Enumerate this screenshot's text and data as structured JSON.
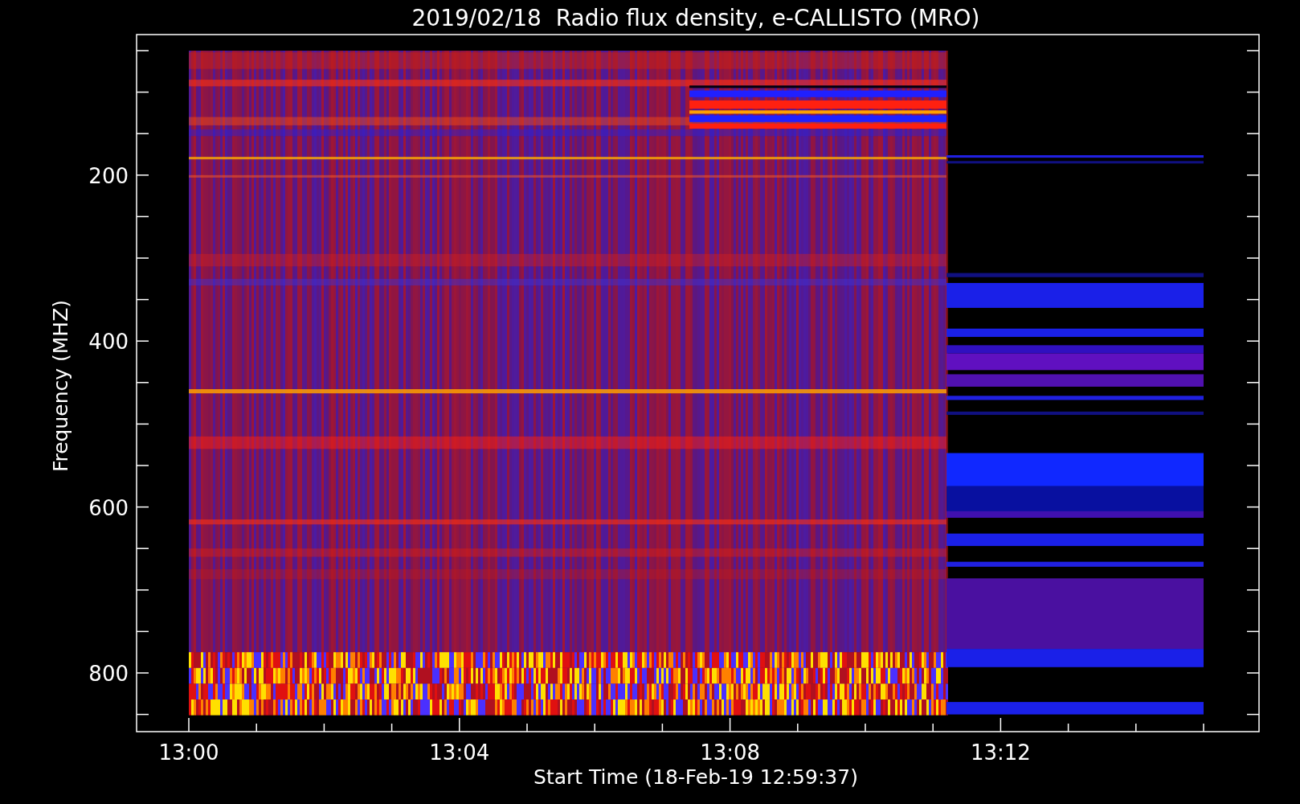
{
  "plot": {
    "title": "2019/02/18  Radio flux density, e-CALLISTO (MRO)",
    "x_axis": {
      "label": "Start Time (18-Feb-19 12:59:37)",
      "tick_labels": [
        "13:00",
        "13:04",
        "13:08",
        "13:12"
      ]
    },
    "y_axis": {
      "label": "Frequency (MHZ)",
      "tick_labels": [
        "200",
        "400",
        "600",
        "800"
      ]
    }
  }
}
